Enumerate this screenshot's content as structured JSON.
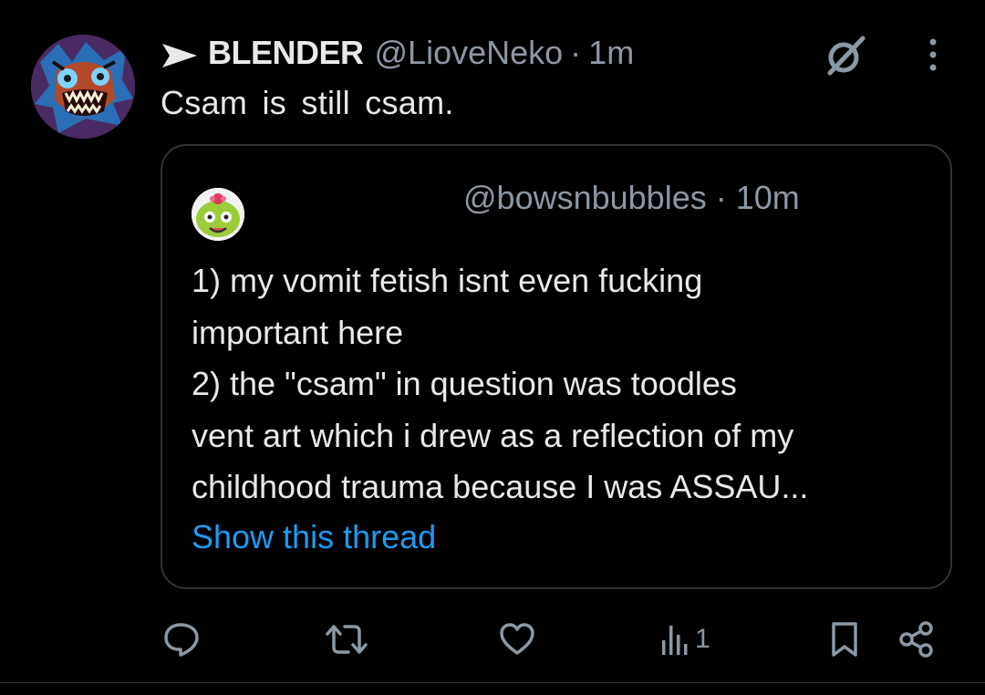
{
  "post": {
    "display_name": "BLENDER",
    "handle": "@LioveNeko",
    "separator": "·",
    "time": "1m",
    "text": "Csam is still csam.",
    "avatar_icon": "monster-avatar",
    "arrow_icon": "right-arrow-icon"
  },
  "quote": {
    "handle": "@bowsnbubbles",
    "separator": "·",
    "time": "10m",
    "lines": [
      "1) my vomit fetish isnt even fucking",
      "important here",
      "2) the \"csam\" in question was toodles",
      "vent art which i drew as a reflection of my",
      "childhood trauma because I was ASSAU..."
    ],
    "show_thread": "Show this thread",
    "link_color": "#1d9bf0"
  },
  "actions": {
    "reply_count": "",
    "repost_count": "",
    "like_count": "",
    "views_count": "1",
    "icons": [
      "reply-icon",
      "repost-icon",
      "like-icon",
      "views-icon",
      "bookmark-icon",
      "share-icon"
    ]
  },
  "colors": {
    "background": "#000000",
    "text": "#e7e9ea",
    "muted": "#8b98a5",
    "border": "#2f3336",
    "accent": "#1d9bf0"
  }
}
